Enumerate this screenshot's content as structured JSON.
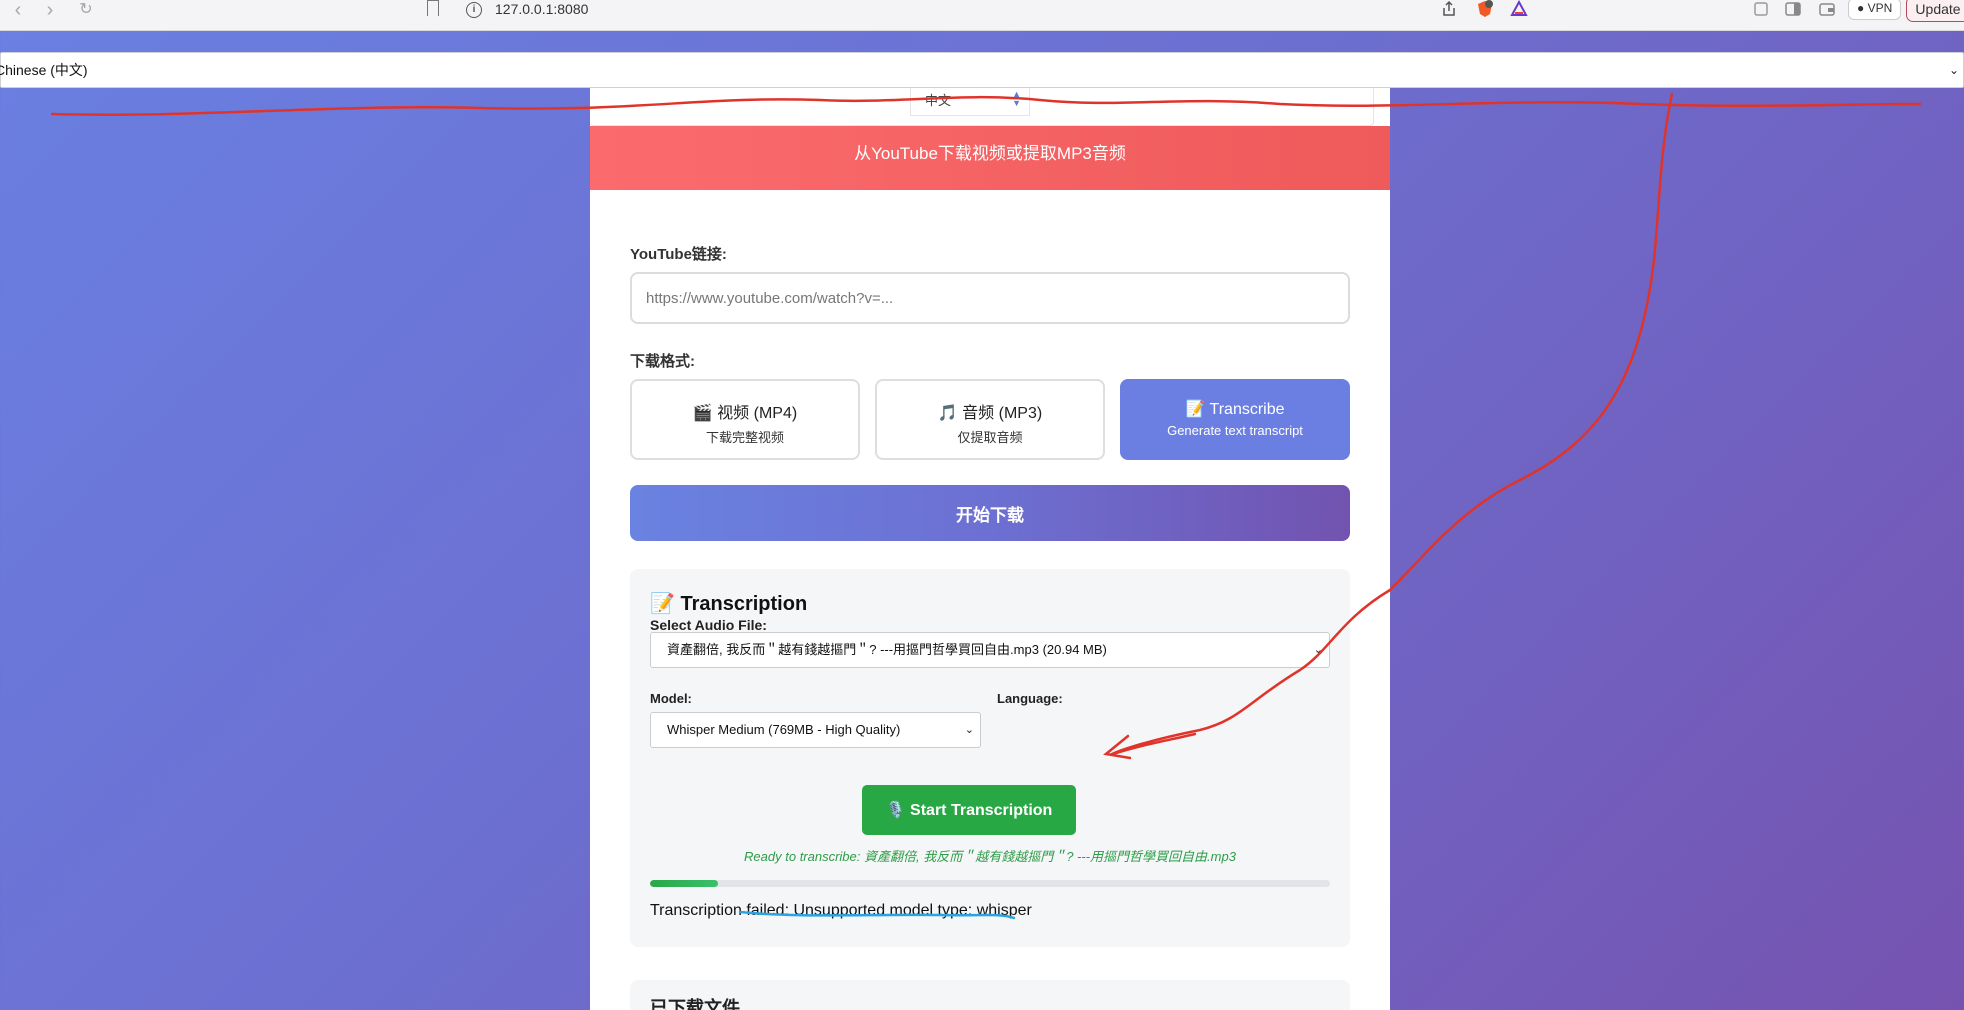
{
  "browser": {
    "url": "127.0.0.1:8080",
    "vpn_label": "VPN",
    "update_label": "Update",
    "shield_badge": "3"
  },
  "language_select": {
    "value": "Chinese (中文)"
  },
  "mini_language": {
    "value": "中文"
  },
  "hero": {
    "subtitle": "从YouTube下载视频或提取MP3音频"
  },
  "form": {
    "url_label": "YouTube链接:",
    "url_placeholder": "https://www.youtube.com/watch?v=...",
    "format_label": "下载格式:",
    "formats": [
      {
        "icon": "🎬",
        "title": "视频 (MP4)",
        "sub": "下载完整视频"
      },
      {
        "icon": "🎵",
        "title": "音频 (MP3)",
        "sub": "仅提取音频"
      },
      {
        "icon": "📝",
        "title": "Transcribe",
        "sub": "Generate text transcript"
      }
    ],
    "selected_format_index": 2,
    "start_download_label": "开始下载"
  },
  "transcription": {
    "title_icon": "📝",
    "title": "Transcription",
    "audio_label": "Select Audio File:",
    "audio_value": "資產翻倍, 我反而＂越有錢越摳門＂? ---用摳門哲學買回自由.mp3 (20.94 MB)",
    "model_label": "Model:",
    "model_value": "Whisper Medium (769MB - High Quality)",
    "language_label": "Language:",
    "start_label": "🎙️ Start Transcription",
    "ready_text": "Ready to transcribe: 資產翻倍, 我反而＂越有錢越摳門＂? ---用摳門哲學買回自由.mp3",
    "progress": 0.1,
    "status_text": "Transcription failed: Unsupported model type: whisper"
  },
  "downloaded": {
    "title": "已下载文件"
  },
  "colors": {
    "accent": "#6b7fe3",
    "hero_red": "#ef5a5a",
    "success_green": "#28a745",
    "annotation_red": "#e0342a",
    "annotation_blue": "#2aa4e0"
  }
}
